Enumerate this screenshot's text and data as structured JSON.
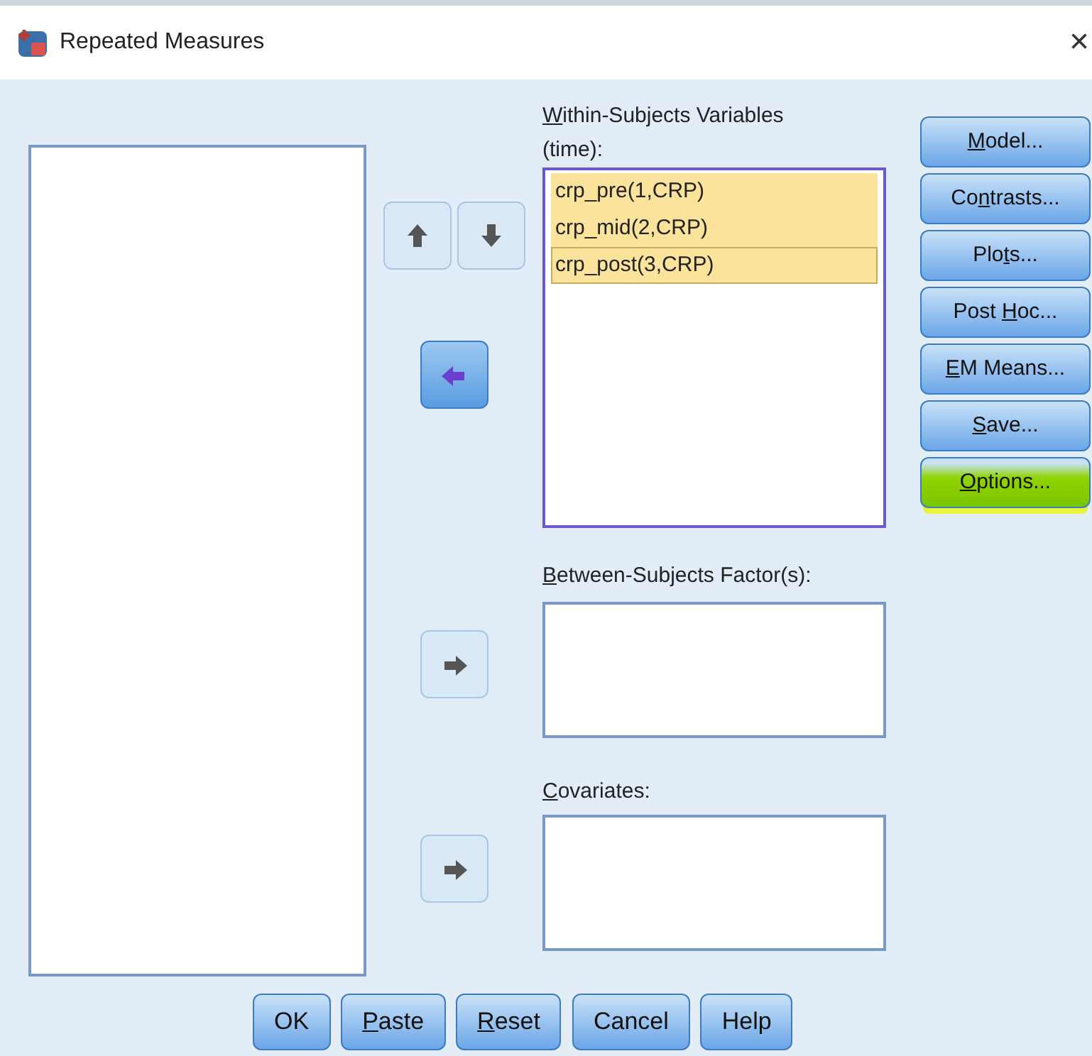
{
  "window": {
    "title": "Repeated Measures",
    "close": "×"
  },
  "within": {
    "label": {
      "key": "W",
      "post": "ithin-Subjects Variables"
    },
    "sublabel": "(time):",
    "items": [
      {
        "text": "crp_pre(1,CRP)",
        "selected": true,
        "focused": false
      },
      {
        "text": "crp_mid(2,CRP)",
        "selected": true,
        "focused": false
      },
      {
        "text": "crp_post(3,CRP)",
        "selected": true,
        "focused": true
      }
    ]
  },
  "order_buttons": [
    {
      "kind": "up",
      "enabled": false
    },
    {
      "kind": "down",
      "enabled": false
    }
  ],
  "transfer_buttons": [
    {
      "kind": "left",
      "enabled": true
    },
    {
      "kind": "right",
      "enabled": false
    },
    {
      "kind": "right",
      "enabled": false
    }
  ],
  "between": {
    "label": {
      "key": "B",
      "post": "etween-Subjects Factor(s):"
    }
  },
  "covariates": {
    "label": {
      "key": "C",
      "post": "ovariates:"
    }
  },
  "side_buttons": [
    {
      "key": "M",
      "post": "odel...",
      "highlighted": false
    },
    {
      "pre": "Co",
      "key": "n",
      "post": "trasts...",
      "highlighted": false
    },
    {
      "pre": "Plo",
      "key": "t",
      "post": "s...",
      "highlighted": false
    },
    {
      "pre": "Post ",
      "key": "H",
      "post": "oc...",
      "highlighted": false
    },
    {
      "key": "E",
      "post": "M Means...",
      "highlighted": false
    },
    {
      "key": "S",
      "post": "ave...",
      "highlighted": false
    },
    {
      "key": "O",
      "post": "ptions...",
      "highlighted": true
    }
  ],
  "bottom_buttons": [
    {
      "pre": "OK"
    },
    {
      "key": "P",
      "post": "aste"
    },
    {
      "key": "R",
      "post": "eset"
    },
    {
      "pre": "Cancel"
    },
    {
      "pre": "Help"
    }
  ]
}
